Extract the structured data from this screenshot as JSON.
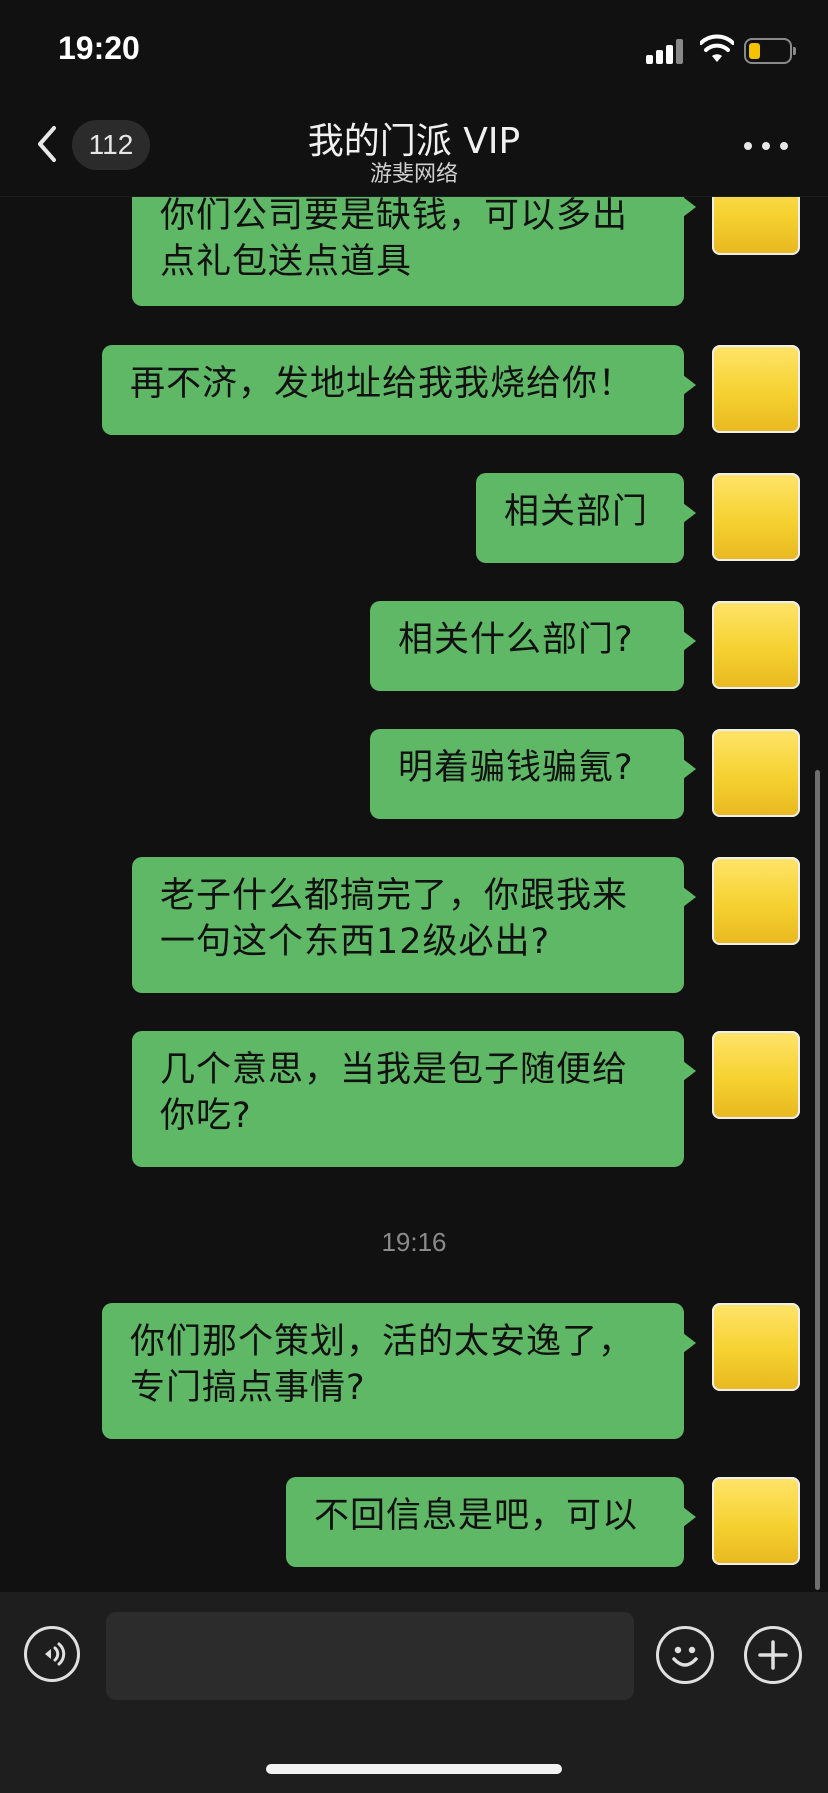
{
  "status_bar": {
    "time": "19:20",
    "battery_color": "#f2c200"
  },
  "header": {
    "unread_count": "112",
    "title": "我的门派 VIP",
    "subtitle": "游斐网络",
    "back_icon": "chevron-left-icon",
    "more_icon": "more-dots-icon"
  },
  "chat": {
    "bubble_color": "#5fb866",
    "messages": [
      {
        "text_line1": "你们公司要是缺钱，可以多出",
        "text_line2": "点礼包送点道具"
      },
      {
        "text": "再不济，发地址给我我烧给你！"
      },
      {
        "text": "相关部门"
      },
      {
        "text": "相关什么部门?"
      },
      {
        "text": "明着骗钱骗氪?"
      },
      {
        "text_line1": "老子什么都搞完了，你跟我来",
        "text_line2": "一句这个东西12级必出?"
      },
      {
        "text_line1": "几个意思，当我是包子随便给",
        "text_line2": "你吃?"
      },
      {
        "text_line1": "你们那个策划，活的太安逸了，",
        "text_line2": "专门搞点事情?"
      },
      {
        "text": "不回信息是吧，可以"
      }
    ],
    "timestamp": "19:16"
  },
  "input_bar": {
    "voice_icon": "voice-input-icon",
    "emoji_icon": "emoji-icon",
    "plus_icon": "plus-icon"
  }
}
